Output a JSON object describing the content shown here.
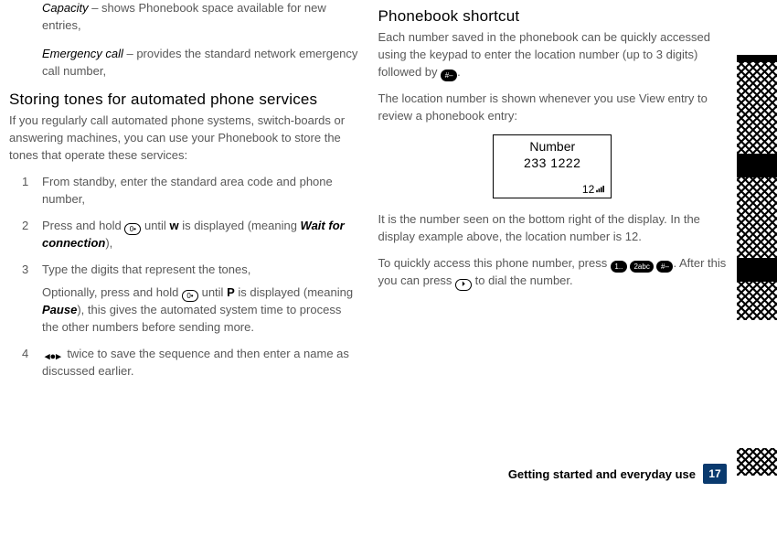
{
  "left": {
    "defs": [
      {
        "term": "Capacity",
        "text": " – shows Phonebook space available for new entries,"
      },
      {
        "term": "Emergency call",
        "text": " – provides the standard network emergency call number,"
      }
    ],
    "heading": "Storing tones for automated phone services",
    "intro": "If you regularly call automated phone systems, switch-boards or answering machines, you can use your Phonebook to store the tones that operate these services:",
    "steps": {
      "s1": "From standby, enter the standard area code and phone number,",
      "s2_a": "Press and hold ",
      "s2_b": " until ",
      "s2_c": " is displayed (meaning ",
      "s2_wait": "Wait for connection",
      "s2_d": "),",
      "s3": "Type the digits that represent the tones,",
      "s3_sub_a": "Optionally, press and hold ",
      "s3_sub_b": " until ",
      "s3_sub_c": " is displayed (meaning ",
      "s3_pause": "Pause",
      "s3_sub_d": "), this gives the automated system time to process the other numbers before sending more.",
      "s4": " twice to save the sequence and then enter a name as discussed earlier."
    },
    "keys": {
      "zero": "0•",
      "w": "w",
      "p": "P"
    }
  },
  "right": {
    "heading": "Phonebook shortcut",
    "p1_a": "Each number saved in the phonebook can be quickly accessed using the keypad to enter the location number (up to 3 digits) followed by ",
    "p1_b": ".",
    "p2": "The location number is shown whenever you use View entry to review a phonebook entry:",
    "display": {
      "title": "Number",
      "value": "233 1222",
      "location": "12"
    },
    "p3": "It is the number seen on the bottom right of the display. In the display example above, the location number is 12.",
    "p4_a": "To quickly access this phone number, press ",
    "p4_b": ". After this you can press ",
    "p4_c": " to dial the number.",
    "keys": {
      "hash": "#–",
      "one": "1..",
      "two": "2abc",
      "call": "⏵"
    }
  },
  "footer": {
    "section": "Getting started and everyday use",
    "page": "17"
  }
}
